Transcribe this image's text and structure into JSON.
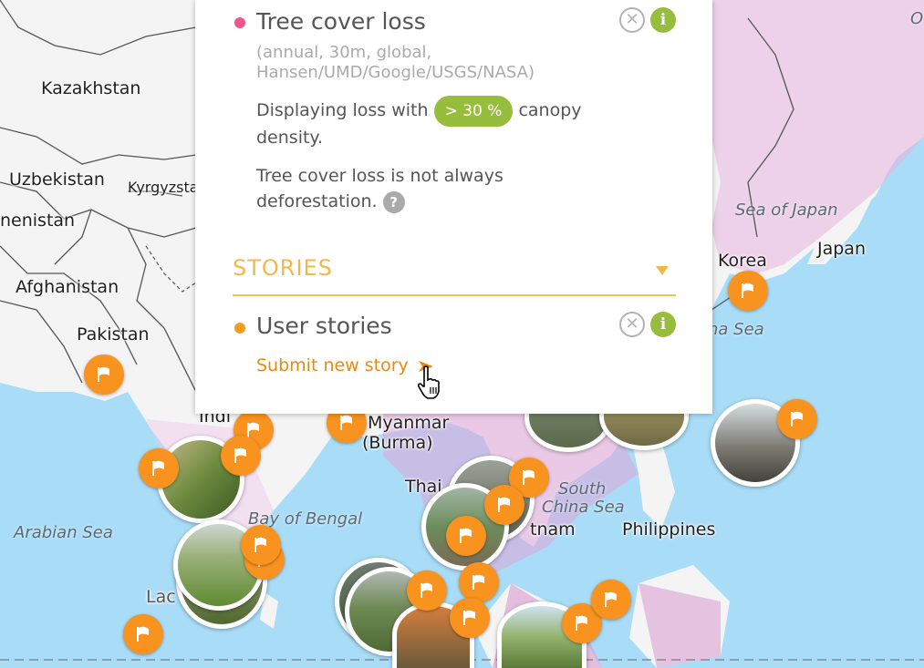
{
  "panel": {
    "tree_cover_loss": {
      "title": "Tree cover loss",
      "subtitle_line1": "(annual, 30m, global,",
      "subtitle_line2": "Hansen/UMD/Google/USGS/NASA)",
      "displaying_prefix": "Displaying loss with",
      "threshold": "> 30 %",
      "canopy_suffix": "canopy",
      "density": "density.",
      "note_line1": "Tree cover loss is not always",
      "note_line2": "deforestation.",
      "help_glyph": "?",
      "dot_color": "#f0558a"
    },
    "stories_section": {
      "title": "STORIES"
    },
    "user_stories": {
      "title": "User stories",
      "submit_link": "Submit new story",
      "dot_color": "#f39b1b"
    },
    "close_glyph": "✕",
    "info_glyph": "i"
  },
  "map": {
    "countries": [
      "Kazakhstan",
      "Uzbekistan",
      "Kyrgyzsta",
      "nenistan",
      "Afghanistan",
      "Pakistan",
      "Indi",
      "Myanmar",
      "(Burma)",
      "Thai",
      "tnam",
      "Philippines",
      "Korea",
      "Japan",
      "Lac"
    ],
    "seas": [
      "Sea of Japan",
      "Arabian Sea",
      "Bay of Bengal",
      "South",
      "China Sea",
      "na Sea"
    ],
    "right_edge_fragment": "O",
    "marker_icon": "flag-icon",
    "accent_color": "#f7931e"
  }
}
